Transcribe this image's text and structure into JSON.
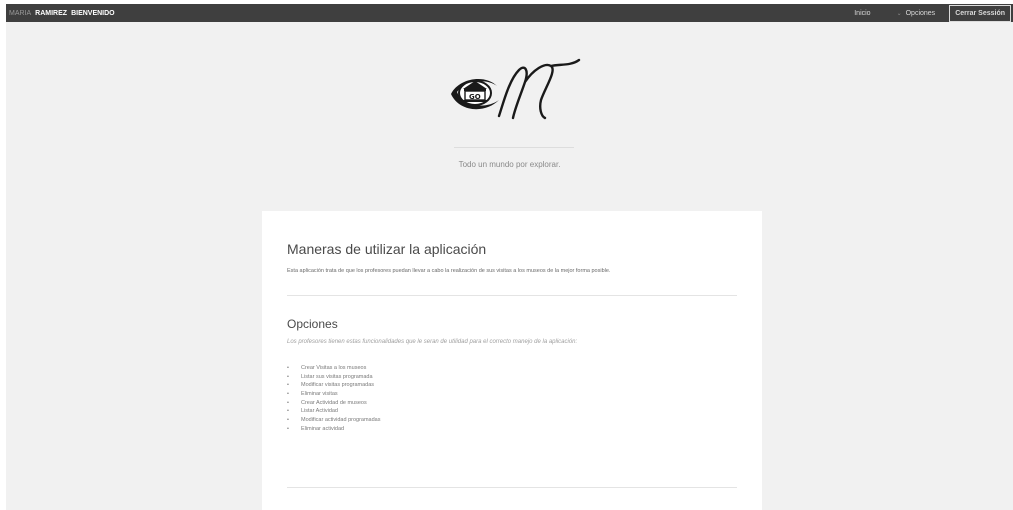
{
  "topbar": {
    "user_first": "MARIA",
    "user_last": "RAMIREZ",
    "greeting": "BIENVENIDO",
    "nav_home": "Inicio",
    "nav_options": "Opciones",
    "logout": "Cerrar Sessión"
  },
  "hero": {
    "logo_icon": "museum-logo-icon",
    "logo_badge": "GO",
    "tagline": "Todo un mundo por explorar."
  },
  "card": {
    "title": "Maneras de utilizar la aplicación",
    "description": "Esta aplicación trata de que los profesores puedan llevar a cabo la realización de sus visitas a los museos de la mejor forma posible.",
    "options_title": "Opciones",
    "options_intro": "Los profesores tienen estas funcionalidades que le seran de utilidad para el correcto manejo de la aplicación:",
    "items": [
      "Crear Visitas a los museos",
      "Listar sus visitas programada",
      "Modificar visitas programadas",
      "Eliminar visitas",
      "Crear Actividad de museos",
      "Listar Actividad",
      "Modificar actividad programadas",
      "Eliminar actividad"
    ]
  }
}
